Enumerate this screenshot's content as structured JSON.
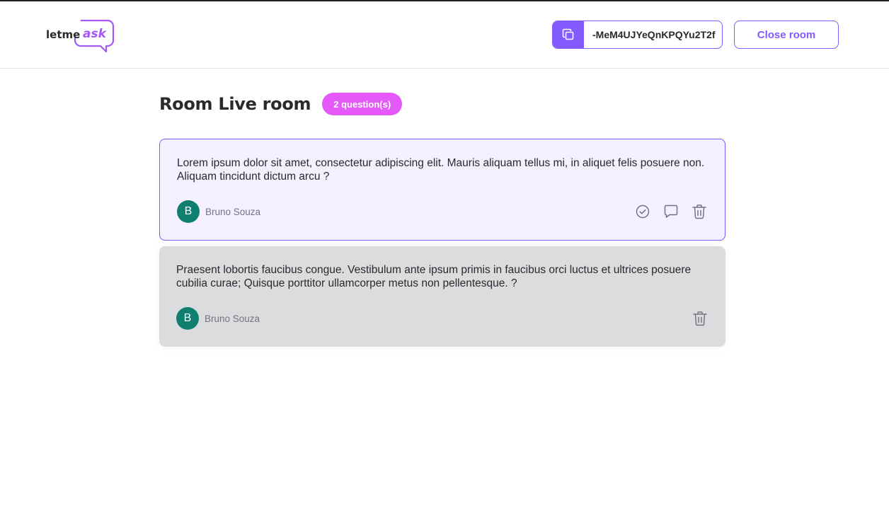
{
  "brand": {
    "logo_word_1": "letme",
    "logo_word_2": "ask",
    "accent": "#835afd",
    "badge_color": "#e559f9",
    "avatar_color": "#0f8070"
  },
  "header": {
    "room_code": "-MeM4UJYeQnKPQYu2T2f",
    "copy_icon": "copy-icon",
    "close_room_label": "Close room"
  },
  "main": {
    "title": "Room Live room",
    "question_count_label": "2 question(s)"
  },
  "questions": [
    {
      "content": "Lorem ipsum dolor sit amet, consectetur adipiscing elit. Mauris aliquam tellus mi, in aliquet felis posuere non. Aliquam tincidunt dictum arcu ?",
      "author_initial": "B",
      "author_name": "Bruno Souza",
      "state": "highlighted",
      "actions": [
        "check-circle-icon",
        "answer-icon",
        "trash-icon"
      ]
    },
    {
      "content": "Praesent lobortis faucibus congue. Vestibulum ante ipsum primis in faucibus orci luctus et ultrices posuere cubilia curae; Quisque porttitor ullamcorper metus non pellentesque. ?",
      "author_initial": "B",
      "author_name": "Bruno Souza",
      "state": "answered",
      "actions": [
        "trash-icon"
      ]
    }
  ]
}
